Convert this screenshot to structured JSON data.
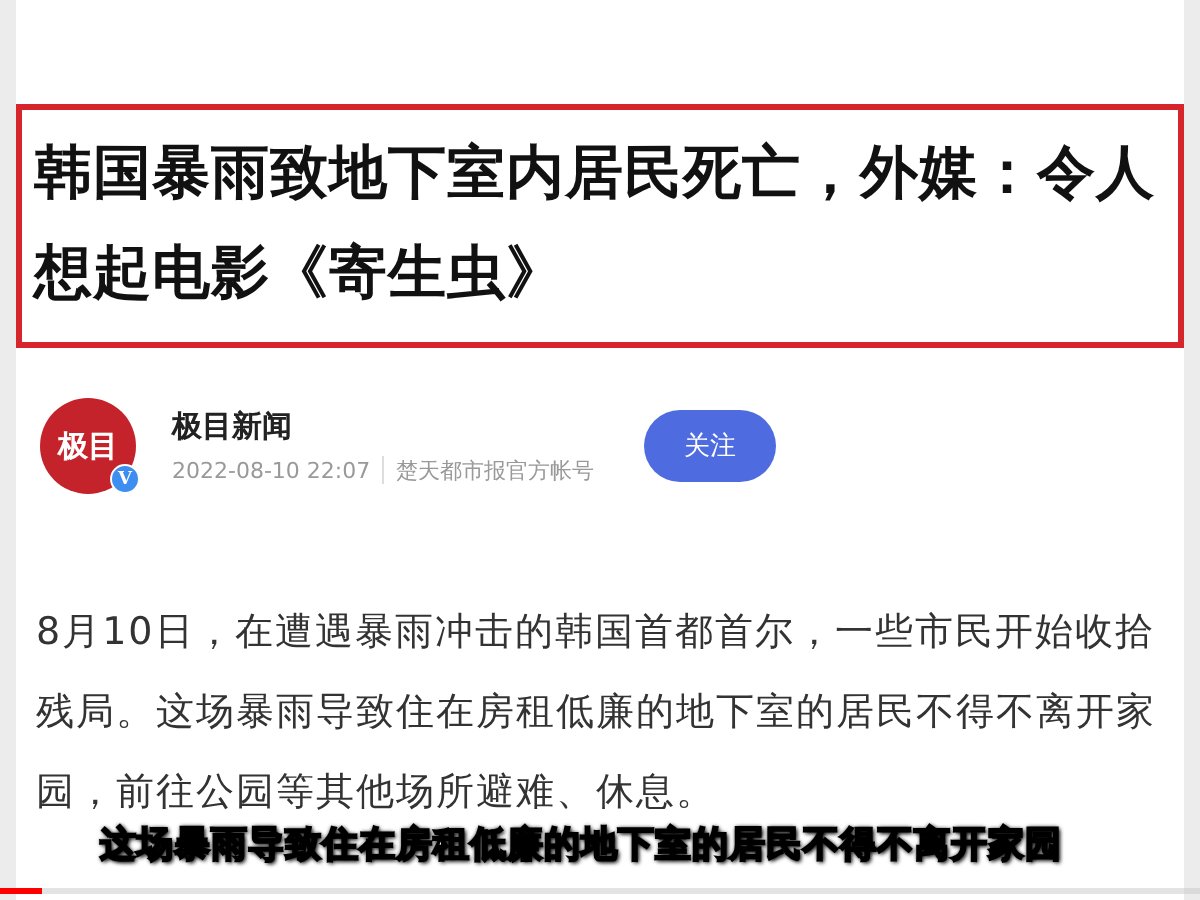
{
  "headline": "韩国暴雨致地下室内居民死亡，外媒：令人想起电影《寄生虫》",
  "author": {
    "logo_text": "极目",
    "verified_mark": "V",
    "name": "极目新闻",
    "time": "2022-08-10 22:07",
    "source": "楚天都市报官方帐号",
    "follow_button": "关注"
  },
  "paragraph": "8月10日，在遭遇暴雨冲击的韩国首都首尔，一些市民开始收拾残局。这场暴雨导致住在房租低廉的地下室的居民不得不离开家园，前往公园等其他场所避难、休息。",
  "subtitle": "这场暴雨导致住在房租低廉的地下室的居民不得不离开家园",
  "video_progress": {
    "level": 0.035
  }
}
